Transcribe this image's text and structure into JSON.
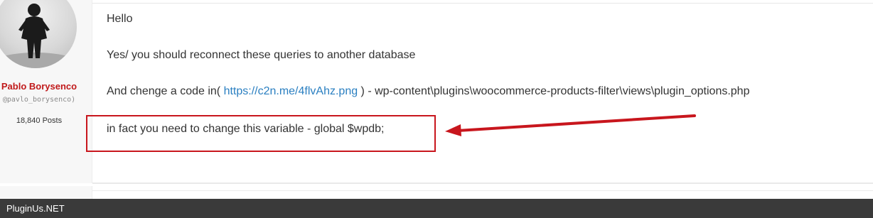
{
  "author": {
    "name": "Pablo Borysenco",
    "handle": "@pavlo_borysenco)",
    "posts": "18,840 Posts",
    "name_color": "#c0191a"
  },
  "post": {
    "greeting": "Hello",
    "line2": "Yes/ you should reconnect these queries to another database",
    "line3_prefix": "And chenge  a code in( ",
    "line3_link": "https://c2n.me/4flvAhz.png",
    "line3_suffix": " ) - wp-content\\plugins\\woocommerce-products-filter\\views\\plugin_options.php",
    "line4": "in fact you need to change this variable - global $wpdb;",
    "link_color": "#2a7fc1"
  },
  "annotation": {
    "color": "#c8161d",
    "type": "arrow-and-box"
  },
  "footer": {
    "brand": "PluginUs.NET",
    "background": "#3a3a3a"
  }
}
